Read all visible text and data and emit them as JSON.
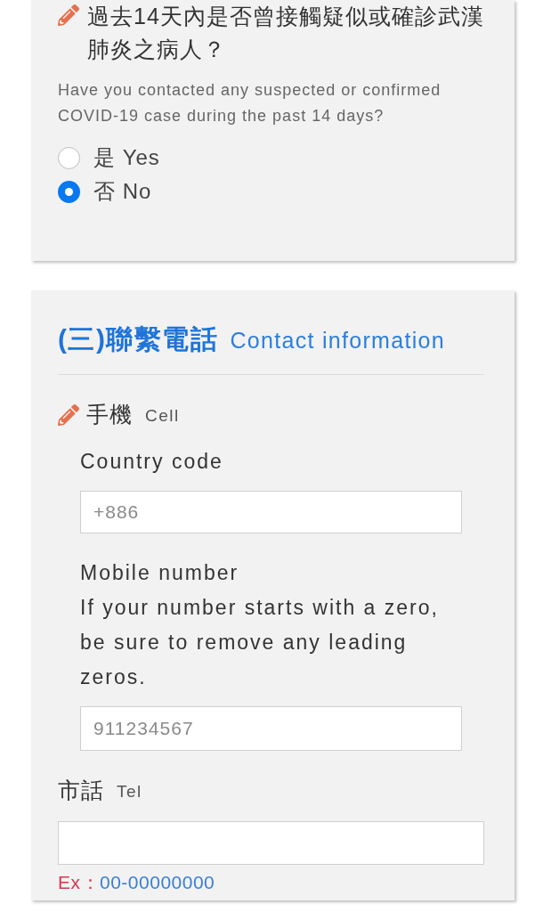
{
  "question": {
    "required": true,
    "title": "過去14天內是否曾接觸疑似或確診武漢肺炎之病人？",
    "subtitle": "Have you contacted any suspected or confirmed COVID-19 case during the past 14 days?",
    "options": [
      {
        "label": "是 Yes",
        "selected": false
      },
      {
        "label": "否 No",
        "selected": true
      }
    ]
  },
  "contact_section": {
    "title": "(三)聯繫電話",
    "subtitle": "Contact information",
    "cell": {
      "required": true,
      "label": "手機",
      "label_en": "Cell",
      "country_code": {
        "label": "Country code",
        "placeholder": "+886"
      },
      "mobile_number": {
        "label": "Mobile number",
        "hint": "If your number starts with a zero, be sure to remove any leading zeros.",
        "placeholder": "911234567"
      }
    },
    "tel": {
      "required": false,
      "label": "市話",
      "label_en": "Tel",
      "example": {
        "label": "Ex：",
        "value": "00-00000000"
      }
    }
  }
}
